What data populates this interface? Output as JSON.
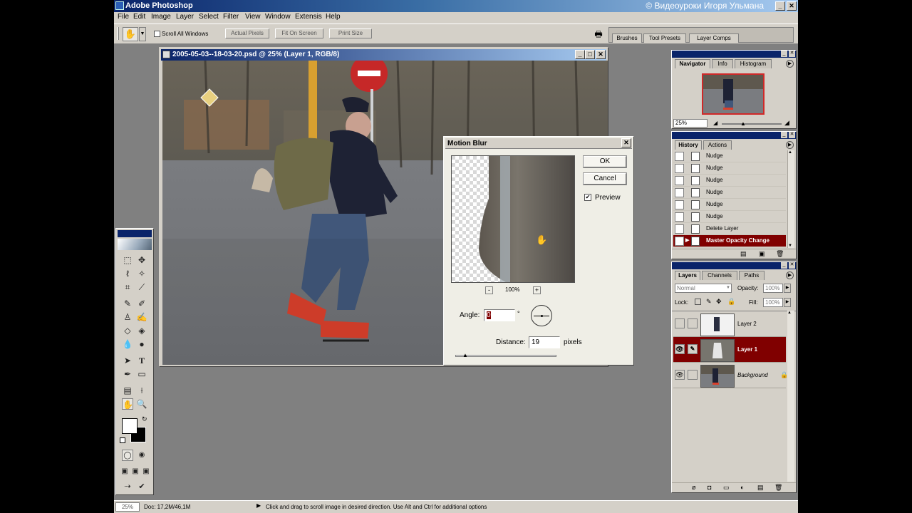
{
  "app": {
    "title": "Adobe Photoshop",
    "watermark": "© Видеоуроки Игоря Ульмана"
  },
  "menu": [
    "File",
    "Edit",
    "Image",
    "Layer",
    "Select",
    "Filter",
    "View",
    "Window",
    "Extensis",
    "Help"
  ],
  "options_bar": {
    "scroll_all_windows": "Scroll All Windows",
    "actual_pixels": "Actual Pixels",
    "fit_on_screen": "Fit On Screen",
    "print_size": "Print Size",
    "palette_tabs": [
      "Brushes",
      "Tool Presets",
      "Layer Comps"
    ]
  },
  "document": {
    "title": "2005-05-03--18-03-20.psd @ 25% (Layer 1, RGB/8)"
  },
  "dialog": {
    "title": "Motion Blur",
    "ok": "OK",
    "cancel": "Cancel",
    "preview_label": "Preview",
    "preview_checked": true,
    "zoom": "100%",
    "zoom_minus": "-",
    "zoom_plus": "+",
    "angle_label": "Angle:",
    "angle_value": "0",
    "degree_symbol": "°",
    "distance_label": "Distance:",
    "distance_value": "19",
    "distance_unit": "pixels"
  },
  "navigator": {
    "tabs": [
      "Navigator",
      "Info",
      "Histogram"
    ],
    "zoom": "25%"
  },
  "history": {
    "tabs": [
      "History",
      "Actions"
    ],
    "items": [
      "Nudge",
      "Nudge",
      "Nudge",
      "Nudge",
      "Nudge",
      "Nudge",
      "Delete Layer",
      "Master Opacity Change"
    ],
    "selected_index": 7
  },
  "layers": {
    "tabs": [
      "Layers",
      "Channels",
      "Paths"
    ],
    "blend_mode": "Normal",
    "opacity_label": "Opacity:",
    "opacity": "100%",
    "lock_label": "Lock:",
    "fill_label": "Fill:",
    "fill": "100%",
    "items": [
      {
        "name": "Layer 2",
        "visible": false,
        "selected": false
      },
      {
        "name": "Layer 1",
        "visible": true,
        "selected": true
      },
      {
        "name": "Background",
        "visible": true,
        "selected": false
      }
    ]
  },
  "status": {
    "zoom": "25%",
    "doc": "Doc: 17,2M/46,1M",
    "hint": "Click and drag to scroll image in desired direction.  Use Alt and Ctrl for additional options"
  },
  "colors": {
    "title_active": "#0a246a",
    "panel_bg": "#d4d0c8",
    "selection": "#800000",
    "workspace": "#808080"
  }
}
